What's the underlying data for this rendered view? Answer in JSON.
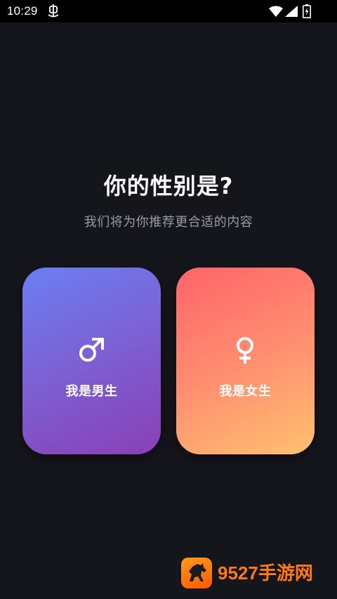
{
  "status_bar": {
    "time": "10:29",
    "app_icon": "bug-icon",
    "icons": [
      "wifi-icon",
      "cellular-signal-icon",
      "battery-charging-icon"
    ]
  },
  "page": {
    "title": "你的性别是?",
    "subtitle": "我们将为你推荐更合适的内容"
  },
  "options": {
    "male": {
      "label": "我是男生",
      "icon": "male-symbol-icon",
      "gradient": [
        "#6b7ff3",
        "#8a3fb6"
      ]
    },
    "female": {
      "label": "我是女生",
      "icon": "female-symbol-icon",
      "gradient": [
        "#ff6469",
        "#ffc170"
      ]
    }
  },
  "watermark": {
    "text": "9527手游网",
    "logo": "horse-logo-icon"
  },
  "colors": {
    "background": "#15151c",
    "title": "#ffffff",
    "subtitle": "#9a9aa3",
    "watermark": "#ff7a12"
  }
}
